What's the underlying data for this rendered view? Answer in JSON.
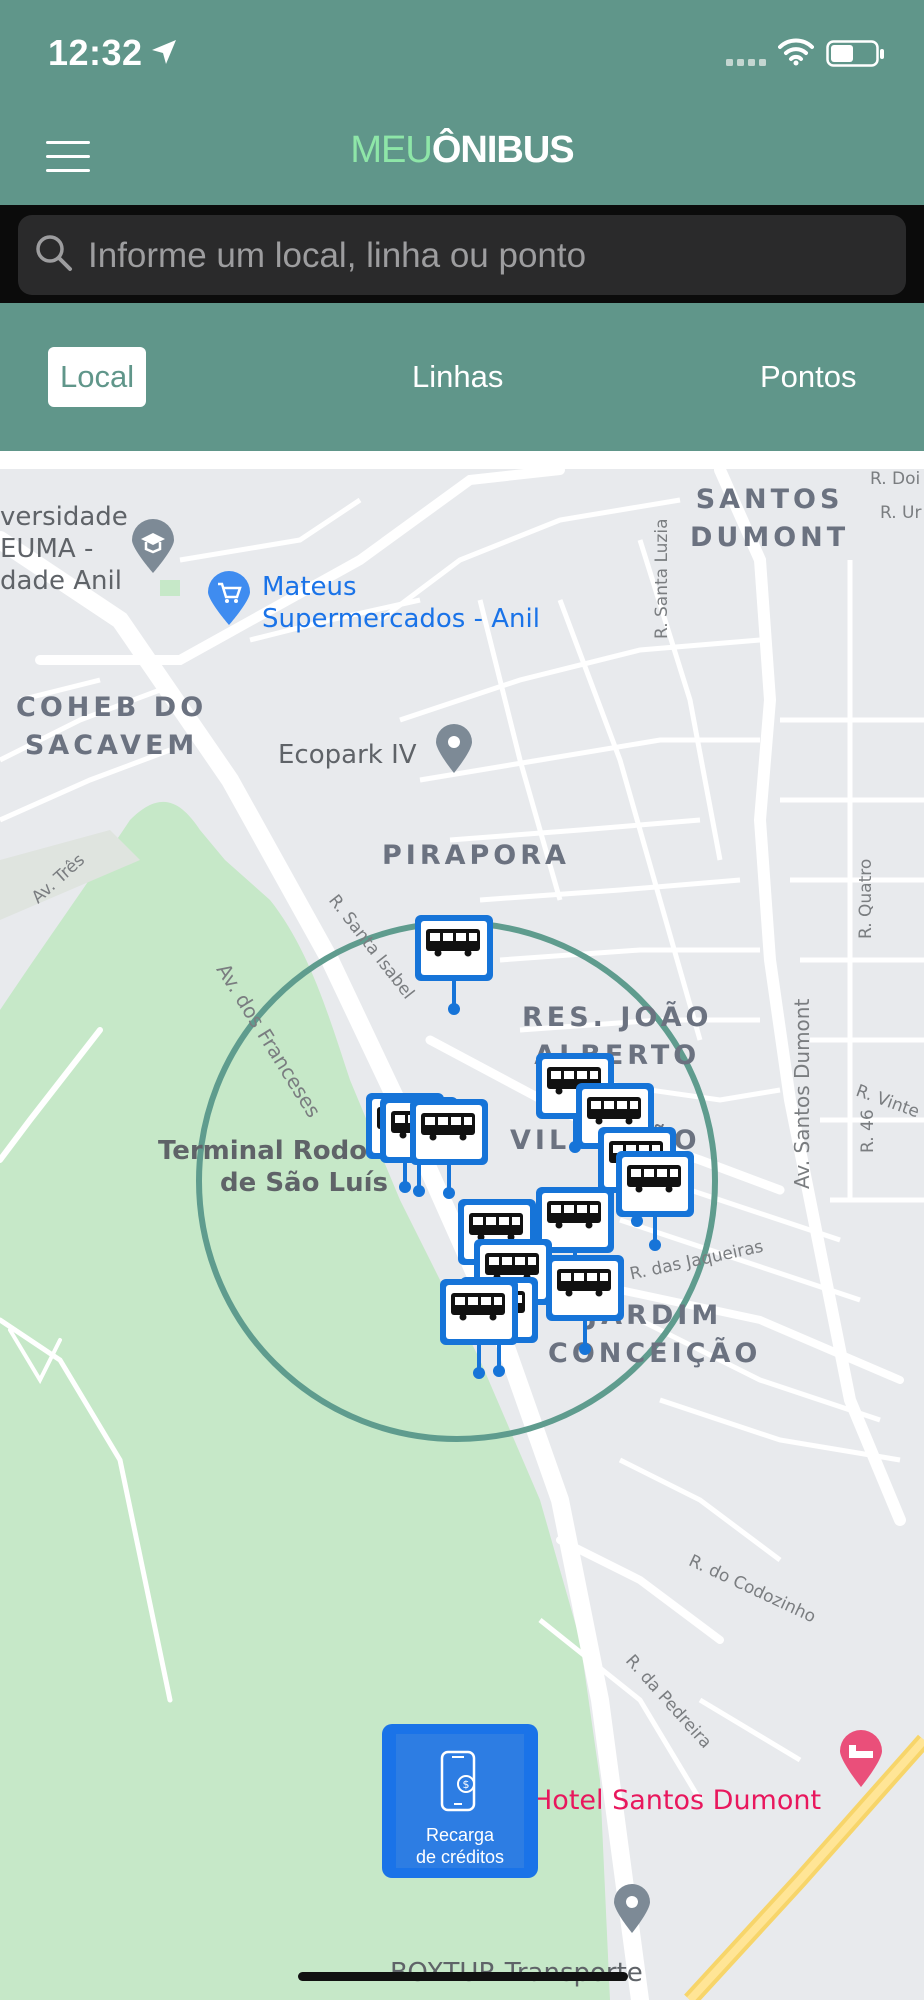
{
  "status_bar": {
    "time": "12:32"
  },
  "app": {
    "logo_part1": "MEU",
    "logo_part2": "ÔNIBUS"
  },
  "search": {
    "placeholder": "Informe um local, linha ou ponto"
  },
  "tabs": [
    {
      "label": "Local",
      "active": true
    },
    {
      "label": "Linhas",
      "active": false
    },
    {
      "label": "Pontos",
      "active": false
    }
  ],
  "map": {
    "neighborhoods": {
      "santos_dumont": "SANTOS\nDUMONT",
      "coheb": "COHEB DO\nSACAVEM",
      "pirapora": "PIRAPORA",
      "res_joao_alberto": "RES. JOÃO\nALBERTO",
      "vila": "VILA JOÃO",
      "jardim": "JARDIM\nCONCEIÇÃO"
    },
    "pois": {
      "university": "versidade\nEUMA -\ndade Anil",
      "mateus": "Mateus\nSupermercados - Anil",
      "ecopark": "Ecopark IV",
      "terminal": "Terminal Rodoviário\nde São Luís",
      "hotel": "Hotel Santos Dumont",
      "boxtur": "BOXTUR Transporte"
    },
    "streets": {
      "av_frances": "Av. dos Franceses",
      "r_santa_isabel": "R. Santa Isabel",
      "r_santa_luzia": "R. Santa Luzia",
      "av_tres": "Av. Três",
      "av_santos_dumont": "Av. Santos Dumont",
      "r_quatro": "R. Quatro",
      "r_vinte": "R. Vinte",
      "r_46": "R. 46",
      "r_jaqueiras": "R. das Jaqueiras",
      "r_codozinho": "R. do Codozinho",
      "r_pedreira": "R. da Pedreira",
      "r_doi": "R. Doi",
      "r_un": "R. Ur"
    },
    "bus_stop_count": 15
  },
  "recharge_button": {
    "line1": "Recarga",
    "line2": "de créditos"
  },
  "colors": {
    "header": "#60968a",
    "logo_accent": "#8ee6a8",
    "pin": "#1674d8",
    "radius_circle": "#5f9c8e"
  }
}
